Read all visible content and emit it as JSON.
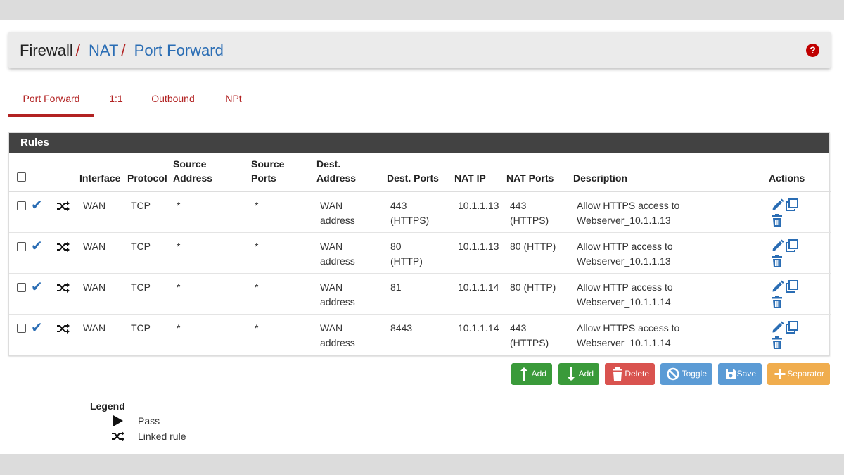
{
  "breadcrumb": {
    "root": "Firewall",
    "separator": "/",
    "level2": "NAT",
    "current": "Port Forward"
  },
  "help_icon": "?",
  "tabs": [
    {
      "label": "Port Forward",
      "active": true
    },
    {
      "label": "1:1",
      "active": false
    },
    {
      "label": "Outbound",
      "active": false
    },
    {
      "label": "NPt",
      "active": false
    }
  ],
  "rules": {
    "title": "Rules",
    "headers": {
      "interface": "Interface",
      "protocol": "Protocol",
      "source_address": "Source Address",
      "source_ports": "Source Ports",
      "dest_address": "Dest. Address",
      "dest_ports": "Dest. Ports",
      "nat_ip": "NAT IP",
      "nat_ports": "NAT Ports",
      "description": "Description",
      "actions": "Actions"
    },
    "rows": [
      {
        "interface": "WAN",
        "protocol": "TCP",
        "source_address": "*",
        "source_ports": "*",
        "dest_address": "WAN address",
        "dest_ports": "443 (HTTPS)",
        "nat_ip": "10.1.1.13",
        "nat_ports": "443 (HTTPS)",
        "description": "Allow HTTPS access to Webserver_10.1.1.13"
      },
      {
        "interface": "WAN",
        "protocol": "TCP",
        "source_address": "*",
        "source_ports": "*",
        "dest_address": "WAN address",
        "dest_ports": "80 (HTTP)",
        "nat_ip": "10.1.1.13",
        "nat_ports": "80 (HTTP)",
        "description": "Allow HTTP access to Webserver_10.1.1.13"
      },
      {
        "interface": "WAN",
        "protocol": "TCP",
        "source_address": "*",
        "source_ports": "*",
        "dest_address": "WAN address",
        "dest_ports": "81",
        "nat_ip": "10.1.1.14",
        "nat_ports": "80 (HTTP)",
        "description": "Allow HTTP access to Webserver_10.1.1.14"
      },
      {
        "interface": "WAN",
        "protocol": "TCP",
        "source_address": "*",
        "source_ports": "*",
        "dest_address": "WAN address",
        "dest_ports": "8443",
        "nat_ip": "10.1.1.14",
        "nat_ports": "443 (HTTPS)",
        "description": "Allow HTTPS access to Webserver_10.1.1.14"
      }
    ]
  },
  "buttons": {
    "add_top": "Add",
    "add_bottom": "Add",
    "delete": "Delete",
    "toggle": "Toggle",
    "save": "Save",
    "separator": "Separator"
  },
  "legend": {
    "title": "Legend",
    "pass": "Pass",
    "linked_rule": "Linked rule"
  },
  "colors": {
    "accent_red": "#b22222",
    "link_blue": "#2a6db4",
    "header_dark": "#424242",
    "btn_green": "#3a9a3a",
    "btn_red": "#d9534f",
    "btn_blue": "#5b9bd5",
    "btn_orange": "#f0ad4e"
  }
}
